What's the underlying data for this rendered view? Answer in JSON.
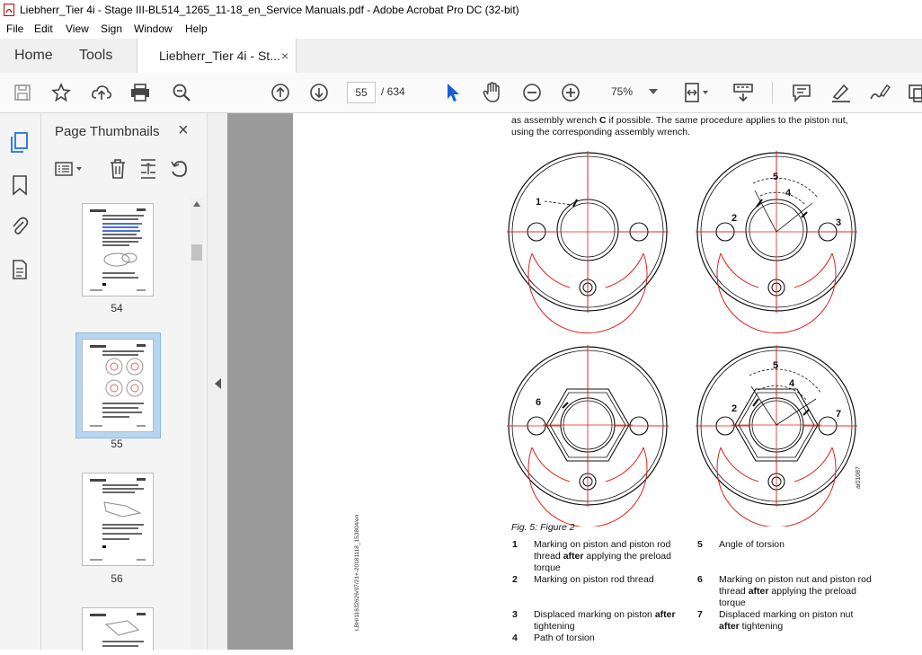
{
  "window": {
    "title": "Liebherr_Tier 4i - Stage III-BL514_1265_11-18_en_Service Manuals.pdf - Adobe Acrobat Pro DC (32-bit)"
  },
  "menu": [
    "File",
    "Edit",
    "View",
    "Sign",
    "Window",
    "Help"
  ],
  "tabs": {
    "home": "Home",
    "tools": "Tools",
    "doc": "Liebherr_Tier 4i - St...",
    "close": "×"
  },
  "toolbar": {
    "current_page": "55",
    "total_pages": "/ 634",
    "zoom": "75%"
  },
  "thumbnails": {
    "title": "Page Thumbnails",
    "close": "×",
    "pages": [
      "54",
      "55",
      "56"
    ]
  },
  "document": {
    "intro_line1": "as assembly wrench ",
    "intro_bold": "C",
    "intro_line1b": " if possible. The same procedure applies to the piston nut,",
    "intro_line2": "using the corresponding assembly wrench.",
    "fig_caption": "Fig. 5: Figure 2",
    "side_code": "LBH/11632626/07/21+-20181118_153804/en",
    "fig_code": "ai01087",
    "callouts": [
      "1",
      "2",
      "3",
      "4",
      "5",
      "6",
      "7"
    ],
    "legend": [
      {
        "num": "1",
        "text": "Marking on piston and piston rod thread ",
        "bold": "after",
        "rest": " applying the preload torque"
      },
      {
        "num": "2",
        "text": "Marking on piston rod thread",
        "bold": "",
        "rest": ""
      },
      {
        "num": "3",
        "text": "Displaced marking on piston ",
        "bold": "after",
        "rest": " tightening"
      },
      {
        "num": "4",
        "text": "Path of torsion",
        "bold": "",
        "rest": ""
      },
      {
        "num": "5",
        "text": "Angle of torsion",
        "bold": "",
        "rest": ""
      },
      {
        "num": "6",
        "text": "Marking on piston nut and piston rod thread ",
        "bold": "after",
        "rest": " applying the preload torque"
      },
      {
        "num": "7",
        "text": "Displaced marking on piston nut ",
        "bold": "after",
        "rest": " tightening"
      }
    ]
  },
  "colors": {
    "accent": "#1a73e8",
    "doc_bg": "#9a9a9a",
    "red": "#e0231c"
  }
}
